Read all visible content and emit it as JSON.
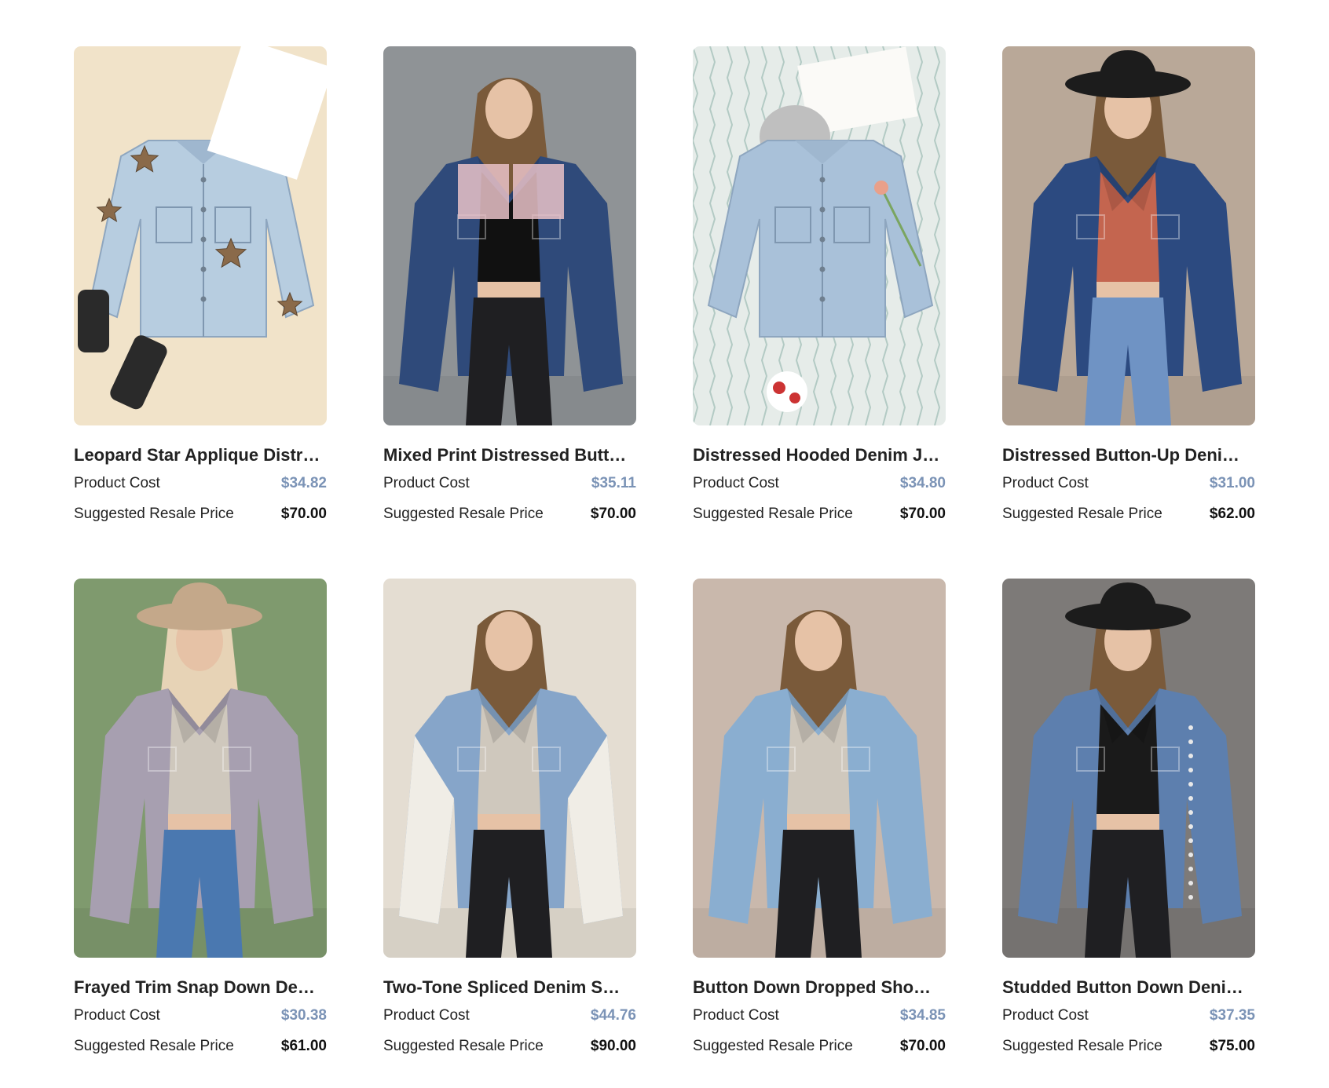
{
  "products": [
    {
      "title": "Leopard Star Applique Distr…",
      "cost_label": "Product Cost",
      "cost": "$34.82",
      "resale_label": "Suggested Resale Price",
      "resale": "$70.00",
      "image": {
        "bg": "#f1e3c9",
        "jacket": "#b7cde0",
        "accent": "#8a6a4a",
        "style": "flatlay-stars"
      }
    },
    {
      "title": "Mixed Print Distressed Butt…",
      "cost_label": "Product Cost",
      "cost": "$35.11",
      "resale_label": "Suggested Resale Price",
      "resale": "$70.00",
      "image": {
        "bg": "#8f9396",
        "jacket": "#2f4a7a",
        "accent": "#e9c2c8",
        "style": "model-dark"
      }
    },
    {
      "title": "Distressed Hooded Denim J…",
      "cost_label": "Product Cost",
      "cost": "$34.80",
      "resale_label": "Suggested Resale Price",
      "resale": "$70.00",
      "image": {
        "bg": "#e6ece9",
        "jacket": "#a9c1d9",
        "accent": "#bfbfbf",
        "style": "flatlay-hood"
      }
    },
    {
      "title": "Distressed Button-Up Deni…",
      "cost_label": "Product Cost",
      "cost": "$31.00",
      "resale_label": "Suggested Resale Price",
      "resale": "$62.00",
      "image": {
        "bg": "#b9a898",
        "jacket": "#2c4a80",
        "accent": "#c4654f",
        "style": "model-hat"
      }
    },
    {
      "title": "Frayed Trim Snap Down De…",
      "cost_label": "Product Cost",
      "cost": "$30.38",
      "resale_label": "Suggested Resale Price",
      "resale": "$61.00",
      "image": {
        "bg": "#7f9a6e",
        "jacket": "#a79fb0",
        "accent": "#d9d4c8",
        "style": "model-hat-light"
      }
    },
    {
      "title": "Two-Tone Spliced Denim S…",
      "cost_label": "Product Cost",
      "cost": "$44.76",
      "resale_label": "Suggested Resale Price",
      "resale": "$90.00",
      "image": {
        "bg": "#e4ddd2",
        "jacket": "#86a5c9",
        "accent": "#f0ede6",
        "style": "model-sherpa"
      }
    },
    {
      "title": "Button Down Dropped Sho…",
      "cost_label": "Product Cost",
      "cost": "$34.85",
      "resale_label": "Suggested Resale Price",
      "resale": "$70.00",
      "image": {
        "bg": "#c9b8ac",
        "jacket": "#8aaed0",
        "accent": "#e0d7cd",
        "style": "model-plain"
      }
    },
    {
      "title": "Studded Button Down Deni…",
      "cost_label": "Product Cost",
      "cost": "$37.35",
      "resale_label": "Suggested Resale Price",
      "resale": "$75.00",
      "image": {
        "bg": "#7d7a78",
        "jacket": "#5d7fae",
        "accent": "#1a1a1a",
        "style": "model-hat-dark"
      }
    }
  ]
}
